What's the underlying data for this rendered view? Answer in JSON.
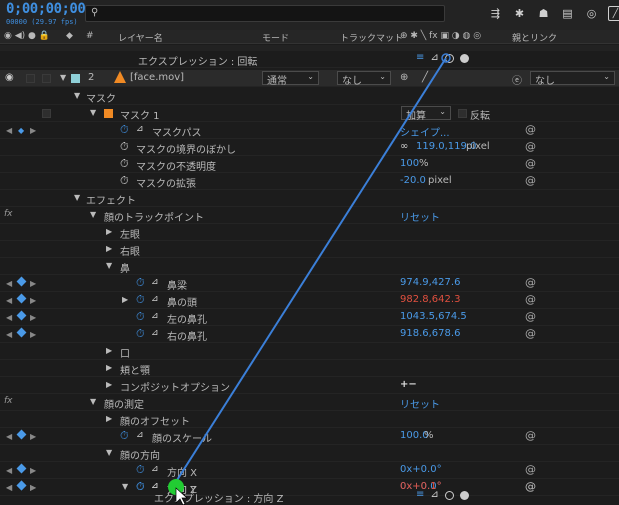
{
  "toolbar": {
    "timecode": "0;00;00;00",
    "fps": "00000 (29.97 fps)",
    "search_icon": "search-icon"
  },
  "columns": {
    "layer_name": "レイヤー名",
    "mode": "モード",
    "track_matte": "トラックマット",
    "parent_link": "親とリンク"
  },
  "expression_rotation": "エクスプレッション : 回転",
  "layer": {
    "number": "2",
    "name": "[face.mov]",
    "mode": "通常",
    "track_matte": "なし",
    "parent": "なし"
  },
  "masks": {
    "group": "マスク",
    "mask1": "マスク 1",
    "mode": "加算",
    "inverted": "反転",
    "path_label": "マスクパス",
    "path_value": "シェイプ...",
    "feather_label": "マスクの境界のぼかし",
    "feather_value": "119.0,119.0",
    "feather_unit": "pixel",
    "opacity_label": "マスクの不透明度",
    "opacity_value": "100",
    "opacity_unit": "%",
    "expansion_label": "マスクの拡張",
    "expansion_value": "-20.0",
    "expansion_unit": "pixel"
  },
  "effects": {
    "group": "エフェクト",
    "face_track": "顔のトラックポイント",
    "reset": "リセット",
    "left_eye": "左眼",
    "right_eye": "右眼",
    "nose": "鼻",
    "nose_bridge": "鼻梁",
    "nose_bridge_value": "974.9,427.6",
    "nose_tip": "鼻の頭",
    "nose_tip_value": "982.8,642.3",
    "left_nostril": "左の鼻孔",
    "left_nostril_value": "1043.5,674.5",
    "right_nostril": "右の鼻孔",
    "right_nostril_value": "918.6,678.6",
    "mouth": "口",
    "cheek_jaw": "頬と顎",
    "composite_options": "コンポジットオプション",
    "plus_minus": "+−",
    "face_measure": "顔の測定",
    "reset2": "リセット",
    "face_offset": "顔のオフセット",
    "face_scale": "顔のスケール",
    "face_scale_value": "100.0",
    "face_scale_unit": "%",
    "face_direction": "顔の方向",
    "dir_x": "方向 X",
    "dir_x_value": "0x+0.0°",
    "dir_y": "方向 Y",
    "dir_y_value": "0x+0.0°",
    "dir_z": "方向 Z",
    "dir_z_value": "0x+0.1°",
    "expression_dir_z": "エクスプレッション : 方向 Z"
  },
  "colors": {
    "accent": "#3f8fe0",
    "highlight_value": "#e0503f",
    "label_orange": "#f08a24",
    "label_cyan": "#8fd0d8",
    "cursor_green": "#22cc33"
  }
}
